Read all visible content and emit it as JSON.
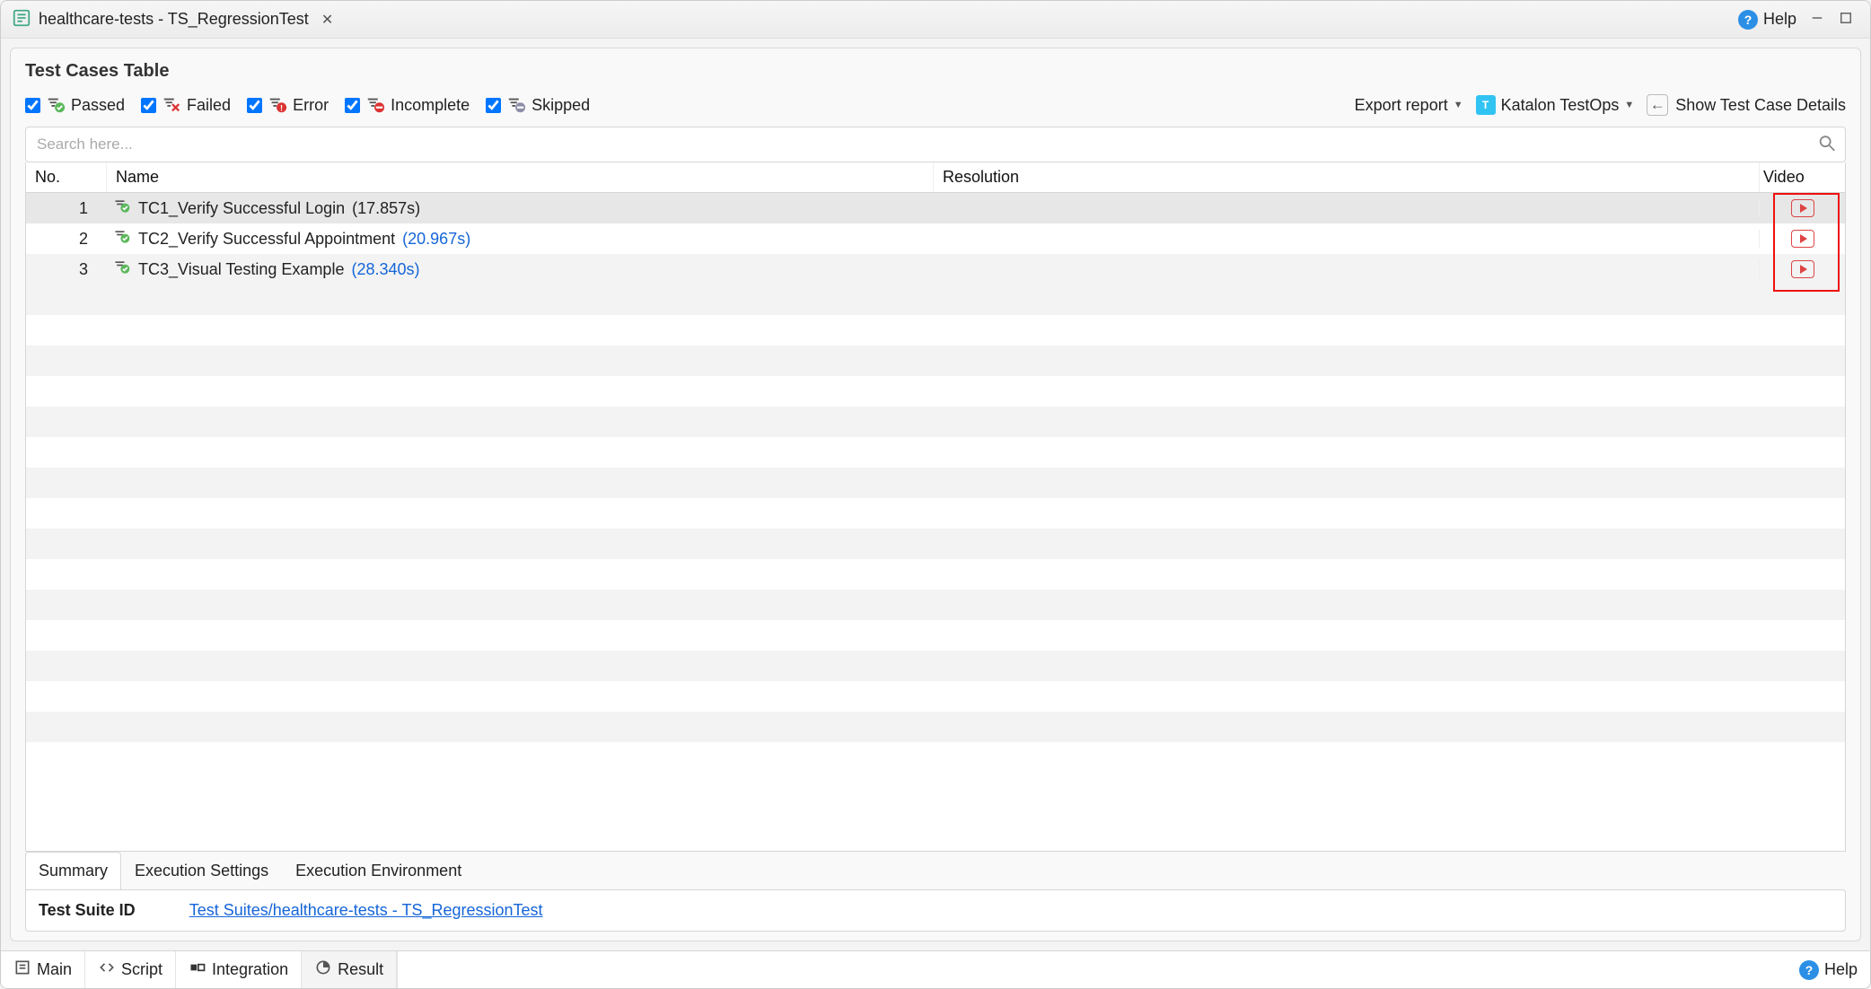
{
  "title": "healthcare-tests - TS_RegressionTest",
  "helpLabel": "Help",
  "panel": {
    "title": "Test Cases Table",
    "filters": [
      {
        "key": "passed",
        "label": "Passed",
        "icon": "pass"
      },
      {
        "key": "failed",
        "label": "Failed",
        "icon": "fail"
      },
      {
        "key": "error",
        "label": "Error",
        "icon": "error"
      },
      {
        "key": "incomplete",
        "label": "Incomplete",
        "icon": "incomplete"
      },
      {
        "key": "skipped",
        "label": "Skipped",
        "icon": "skipped"
      }
    ],
    "actions": {
      "export": "Export report",
      "testops": "Katalon TestOps",
      "showDetails": "Show Test Case Details"
    },
    "search": {
      "placeholder": "Search here..."
    },
    "columns": {
      "no": "No.",
      "name": "Name",
      "resolution": "Resolution",
      "video": "Video"
    },
    "rows": [
      {
        "no": "1",
        "name": "TC1_Verify Successful Login",
        "dur": "(17.857s)",
        "durLink": false,
        "selected": true
      },
      {
        "no": "2",
        "name": "TC2_Verify Successful Appointment",
        "dur": "(20.967s)",
        "durLink": true,
        "selected": false
      },
      {
        "no": "3",
        "name": "TC3_Visual Testing Example",
        "dur": "(28.340s)",
        "durLink": true,
        "selected": false
      }
    ],
    "detailTabs": [
      "Summary",
      "Execution Settings",
      "Execution Environment"
    ],
    "detailActive": 0,
    "detail": {
      "label": "Test Suite ID",
      "value": "Test Suites/healthcare-tests - TS_RegressionTest"
    }
  },
  "bottomTabs": [
    "Main",
    "Script",
    "Integration",
    "Result"
  ],
  "bottomActive": 3
}
